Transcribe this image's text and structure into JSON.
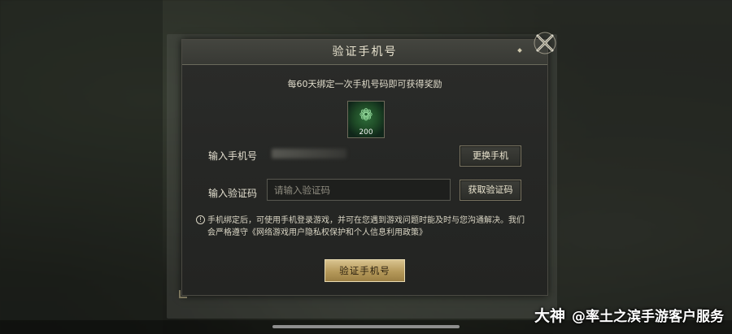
{
  "dialog": {
    "title": "验证手机号",
    "subtitle": "每60天绑定一次手机号码即可获得奖励",
    "reward": {
      "icon": "jade-coin-icon",
      "count": "200"
    },
    "phone_row": {
      "label": "输入手机号",
      "change_button": "更换手机"
    },
    "code_row": {
      "label": "输入验证码",
      "placeholder": "请输入验证码",
      "get_code_button": "获取验证码"
    },
    "notice": "手机绑定后，可使用手机登录游戏，并可在您遇到游戏问题时能及时与您沟通解决。我们会严格遵守《网络游戏用户隐私权保护和个人信息利用政策》",
    "confirm_button": "验证手机号"
  },
  "watermark": {
    "brand": "大神",
    "text": "@率土之滨手游客户服务"
  },
  "colors": {
    "accent_gold": "#b5995a",
    "panel": "#262725",
    "text": "#e3dfcf"
  }
}
